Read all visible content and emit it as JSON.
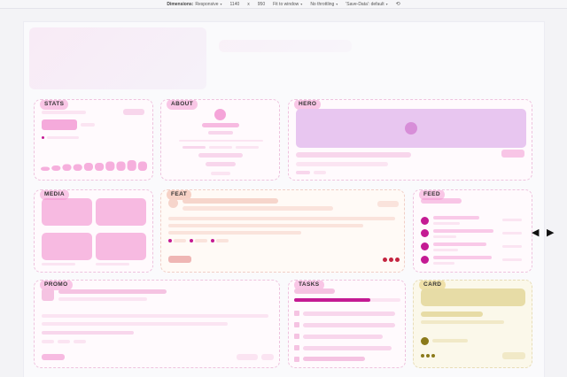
{
  "toolbar": {
    "dimensions_label": "Dimensions:",
    "device": "Responsive",
    "width": "1140",
    "times": "x",
    "height": "950",
    "fit": "Fit to window",
    "throttle": "No throttling",
    "save_data": "'Save-Data': default",
    "rotate_icon": "rotate-icon"
  },
  "sections": {
    "stats": "STATS",
    "about": "ABOUT",
    "hero": "HERO",
    "media": "MEDIA",
    "feat": "FEAT",
    "feed": "FEED",
    "promo": "PROMO",
    "tasks": "TASKS",
    "card": "CARD"
  },
  "stats_chart": {
    "type": "bar",
    "values": [
      3,
      4,
      5,
      5,
      6,
      6,
      7,
      7,
      8,
      7
    ]
  },
  "tasks_progress": 0.72,
  "handles": {
    "left": "◀",
    "right": "▶"
  },
  "colors": {
    "accent_pink": "#f28fcf",
    "accent_magenta": "#c41a93",
    "hero_lavender": "#e8c6f0",
    "card_olive": "#8b7a1a"
  }
}
